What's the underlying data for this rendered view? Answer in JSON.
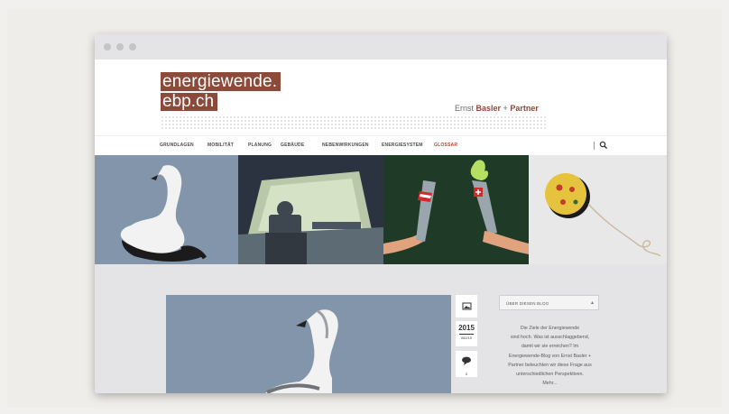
{
  "site": {
    "logo_line1": "energiewende.",
    "logo_line2": "ebp.ch",
    "partner_prefix": "Ernst ",
    "partner_bold": "Basler",
    "partner_plus": " + ",
    "partner_bold2": "Partner"
  },
  "nav": {
    "items": [
      "GRUNDLAGEN",
      "MOBILITÄT",
      "PLANUNG",
      "GEBÄUDE",
      "NEBENWIRKUNGEN",
      "ENERGIESYSTEM",
      "GLOSSAR"
    ],
    "active_index": 6
  },
  "post": {
    "year": "2015",
    "date": "082/10",
    "comments": "0"
  },
  "sidebar": {
    "select_label": "ÜBER DIESEN BLOG",
    "about_lines": [
      "Die Ziele der Energiewende",
      "sind hoch. Was ist ausschlaggebend,",
      "damit wir sie erreichen? Im",
      "Energiewende-Blog von Ernst Basler +",
      "Partner beleuchten wir diese Frage aus",
      "unterschiedlichen Perspektiven.",
      "Mehr..."
    ]
  },
  "colors": {
    "brand": "#8c4a3a",
    "active_nav": "#b0452e",
    "hero_swan_bg": "#8295aa",
    "hero_control_bg": "#2b3340",
    "hero_torch_bg": "#1f3a27",
    "hero_yoyo_bg": "#e8e8e8"
  }
}
